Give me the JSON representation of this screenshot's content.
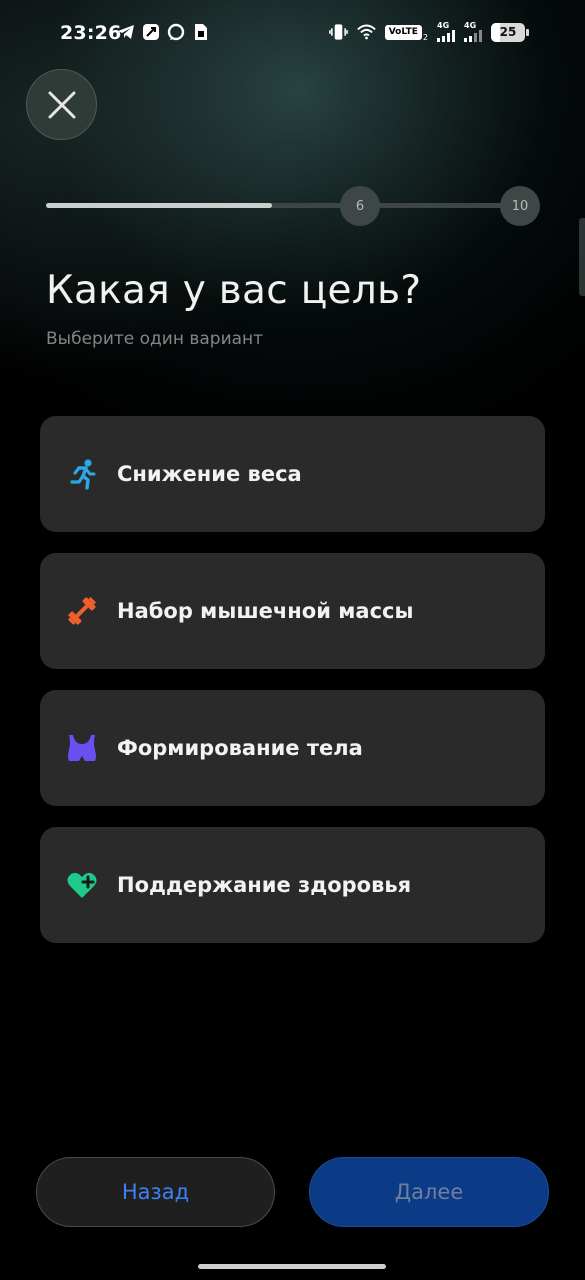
{
  "status_bar": {
    "time": "23:26",
    "network_left": "4G",
    "network_right": "4G",
    "volte": "VoLTE",
    "sim_index": "2",
    "battery_level": "25",
    "battery_fraction": 0.25
  },
  "progress": {
    "current_step": "6",
    "total_steps": "10",
    "fill_fraction": 0.47
  },
  "title": "Какая у вас цель?",
  "subtitle": "Выберите один вариант",
  "options": [
    {
      "label": "Снижение веса",
      "icon": "running-person-icon",
      "color": "#2aa9e8"
    },
    {
      "label": "Набор мышечной массы",
      "icon": "dumbbell-icon",
      "color": "#f0602a"
    },
    {
      "label": "Формирование тела",
      "icon": "body-shape-icon",
      "color": "#6b4ff0"
    },
    {
      "label": "Поддержание здоровья",
      "icon": "heart-plus-icon",
      "color": "#1fc98a"
    }
  ],
  "buttons": {
    "back": "Назад",
    "next": "Далее"
  },
  "colors": {
    "back_text": "#3b82f6",
    "next_bg": "#0b3a86"
  }
}
